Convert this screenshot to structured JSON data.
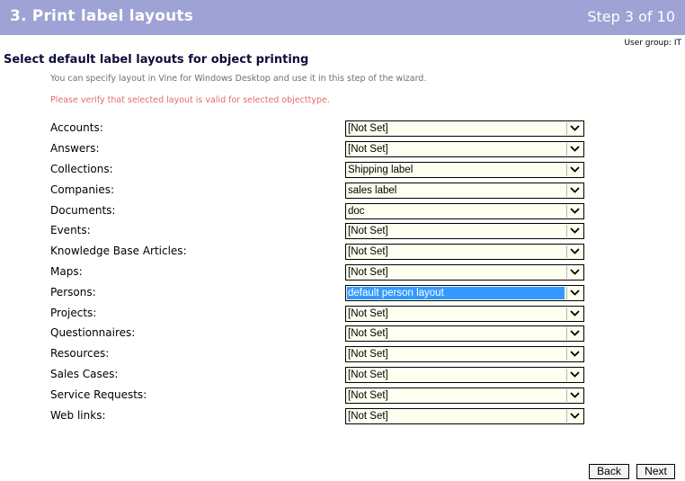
{
  "header": {
    "title": "3. Print label layouts",
    "step": "Step 3 of 10"
  },
  "user_group": "User group: IT",
  "section_title": "Select default label layouts for object printing",
  "info_text": "You can specify layout in Vine for Windows Desktop and use it in this step of the wizard.",
  "warning_text": "Please verify that selected layout is valid for selected objecttype.",
  "rows": [
    {
      "label": "Accounts:",
      "value": "[Not Set]"
    },
    {
      "label": "Answers:",
      "value": "[Not Set]"
    },
    {
      "label": "Collections:",
      "value": "Shipping label"
    },
    {
      "label": "Companies:",
      "value": "sales label"
    },
    {
      "label": "Documents:",
      "value": "doc"
    },
    {
      "label": "Events:",
      "value": "[Not Set]"
    },
    {
      "label": "Knowledge Base Articles:",
      "value": "[Not Set]"
    },
    {
      "label": "Maps:",
      "value": "[Not Set]"
    },
    {
      "label": "Persons:",
      "value": "default person layout"
    },
    {
      "label": "Projects:",
      "value": "[Not Set]"
    },
    {
      "label": "Questionnaires:",
      "value": "[Not Set]"
    },
    {
      "label": "Resources:",
      "value": "[Not Set]"
    },
    {
      "label": "Sales Cases:",
      "value": "[Not Set]"
    },
    {
      "label": "Service Requests:",
      "value": "[Not Set]"
    },
    {
      "label": "Web links:",
      "value": "[Not Set]"
    }
  ],
  "icons": {
    "dropdown": "chevron-down-icon"
  },
  "colors": {
    "header_bg": "#9ea2d4",
    "select_bg": "#fffff0",
    "selection": "#3399ff",
    "warning": "#e26b6b"
  },
  "buttons": {
    "back": "Back",
    "next": "Next"
  }
}
